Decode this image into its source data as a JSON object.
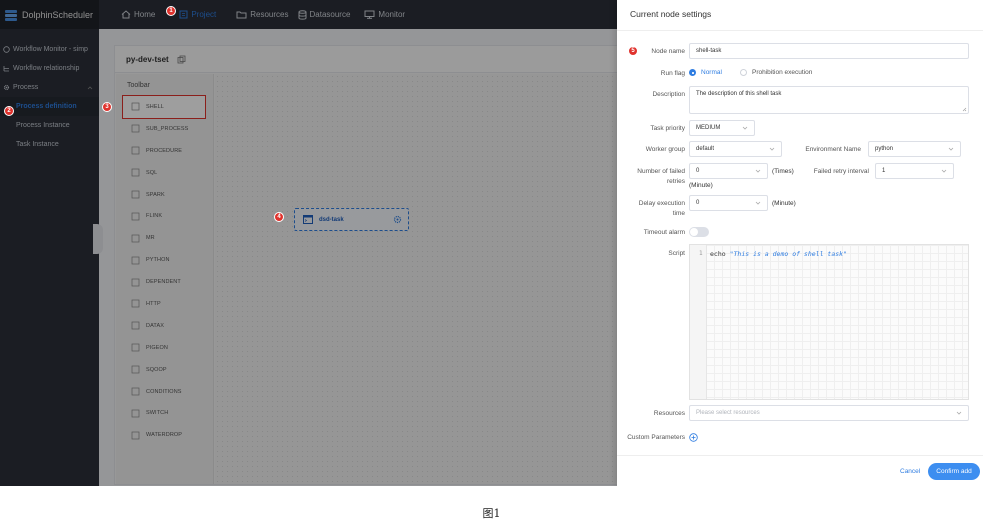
{
  "header": {
    "brand": "DolphinScheduler",
    "nav": [
      {
        "label": "Home",
        "icon": "home-icon"
      },
      {
        "label": "Project",
        "icon": "project-icon",
        "active": true
      },
      {
        "label": "Resources",
        "icon": "folder-icon"
      },
      {
        "label": "Datasource",
        "icon": "database-icon"
      },
      {
        "label": "Monitor",
        "icon": "monitor-icon"
      }
    ]
  },
  "sidebar": {
    "items": [
      {
        "label": "Workflow Monitor - simp",
        "icon": "monitor-icon"
      },
      {
        "label": "Workflow relationship",
        "icon": "relation-icon"
      },
      {
        "label": "Process",
        "icon": "gear-icon"
      },
      {
        "label": "Process definition",
        "active": true
      },
      {
        "label": "Process Instance"
      },
      {
        "label": "Task Instance"
      }
    ]
  },
  "panel": {
    "project_name": "py-dev-tset",
    "toolbar_title": "Toolbar",
    "tools": [
      "SHELL",
      "SUB_PROCESS",
      "PROCEDURE",
      "SQL",
      "SPARK",
      "FLINK",
      "MR",
      "PYTHON",
      "DEPENDENT",
      "HTTP",
      "DATAX",
      "PIGEON",
      "SQOOP",
      "CONDITIONS",
      "SWITCH",
      "WATERDROP"
    ],
    "task_node_label": "dsd-task"
  },
  "badges": [
    "1",
    "2",
    "3",
    "4",
    "5"
  ],
  "drawer": {
    "title": "Current node settings",
    "node_name_label": "Node name",
    "node_name_value": "shell-task",
    "run_flag_label": "Run flag",
    "run_flag_options": [
      "Normal",
      "Prohibition execution"
    ],
    "description_label": "Description",
    "description_value": "The description of this shell task",
    "task_priority_label": "Task priority",
    "task_priority_value": "MEDIUM",
    "worker_group_label": "Worker group",
    "worker_group_value": "default",
    "environment_label": "Environment Name",
    "environment_value": "python",
    "failed_retries_label_1": "Number of failed",
    "failed_retries_label_2": "retries",
    "failed_retries_value": "0",
    "failed_retries_unit": "(Times)",
    "retry_interval_label": "Failed retry interval",
    "retry_interval_value": "1",
    "retry_interval_unit": "(Minute)",
    "delay_label_1": "Delay execution",
    "delay_label_2": "time",
    "delay_value": "0",
    "delay_unit": "(Minute)",
    "timeout_label": "Timeout alarm",
    "script_label": "Script",
    "script_line_no": "1",
    "script_keyword": "echo",
    "script_string": "\"This is a demo of shell task\"",
    "resources_label": "Resources",
    "resources_placeholder": "Please select resources",
    "custom_params_label": "Custom Parameters",
    "cancel_label": "Cancel",
    "confirm_label": "Confirm add"
  },
  "caption": "图1",
  "colors": {
    "accent": "#2f7de1",
    "badge": "#e0322d",
    "nav_bg": "#2c3039"
  }
}
